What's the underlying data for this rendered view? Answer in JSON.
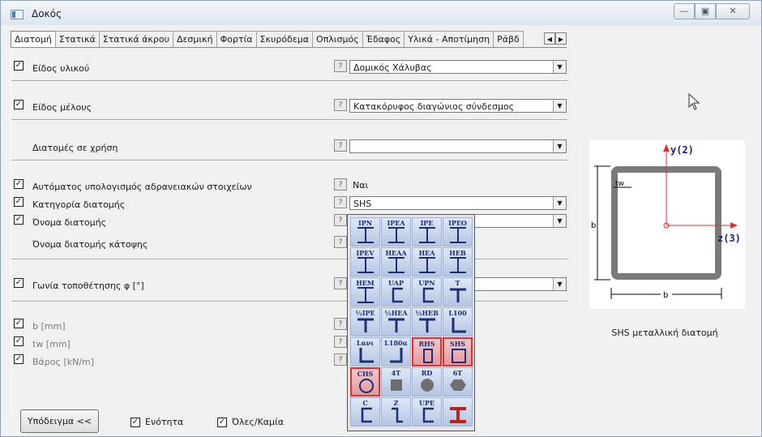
{
  "window": {
    "title": "Δοκός",
    "minimize_glyph": "—",
    "maximize_glyph": "▣",
    "close_glyph": "✕"
  },
  "tabs": [
    "Διατομή",
    "Στατικά",
    "Στατικά άκρου",
    "Δεσμική",
    "Φορτία",
    "Σκυρόδεμα",
    "Οπλισμός",
    "Έδαφος",
    "Υλικά - Αποτίμηση",
    "Ράβδ"
  ],
  "tab_scroll": {
    "left": "◀",
    "right": "▶"
  },
  "properties": {
    "material": {
      "label": "Είδος υλικού",
      "checked": true,
      "value": "Δομικός Χάλυβας"
    },
    "member_type": {
      "label": "Είδος μέλους",
      "checked": true,
      "value": "Κατακόρυφος διαγώνιος σύνδεσμος"
    },
    "sections_in_use": {
      "label": "Διατομές σε χρήση",
      "checked": false,
      "value": ""
    },
    "auto_inertia": {
      "label": "Αυτόματος υπολογισμός αδρανειακών στοιχείων",
      "checked": true,
      "value": "Ναι"
    },
    "section_category": {
      "label": "Κατηγορία διατομής",
      "checked": true,
      "value": "SHS"
    },
    "section_name": {
      "label": "Όνομα διατομής",
      "checked": true,
      "value": ""
    },
    "section_name_plan": {
      "label": "Όνομα διατομής κάτοψης",
      "checked": false,
      "value": ""
    },
    "placement_angle": {
      "label": "Γωνία τοποθέτησης φ [°]",
      "checked": true,
      "value": ""
    },
    "b": {
      "label": "b [mm]",
      "checked": true
    },
    "tw": {
      "label": "tw [mm]",
      "checked": true
    },
    "weight": {
      "label": "Βάρος [kN/m]",
      "checked": true
    }
  },
  "help_glyph": "?",
  "dropdown_glyph": "▼",
  "check_glyph": "✓",
  "section_picker": {
    "rows": [
      [
        "IPN",
        "IPEA",
        "IPE",
        "IPEO"
      ],
      [
        "IPEV",
        "HEAA",
        "HEA",
        "HEB"
      ],
      [
        "HEM",
        "UAP",
        "UPN",
        "T"
      ],
      [
        "½IPE",
        "½HEA",
        "½HEB",
        "L100"
      ],
      [
        "Lανι",
        "L180α",
        "RHS",
        "SHS"
      ],
      [
        "CHS",
        "4T",
        "RD",
        "6T"
      ],
      [
        "C",
        "Z",
        "UPE",
        ""
      ]
    ],
    "selected": [
      "RHS",
      "SHS",
      "CHS"
    ]
  },
  "diagram": {
    "y_axis": "y(2)",
    "z_axis": "z(3)",
    "dim_b": "b",
    "dim_tw": "tw",
    "dim_h": "b",
    "caption": "SHS μεταλλική διατομή"
  },
  "footer": {
    "sample_button": "Υπόδειγμα <<",
    "unit_check": "Ενότητα",
    "all_none_check": "Όλες/Καμία"
  }
}
